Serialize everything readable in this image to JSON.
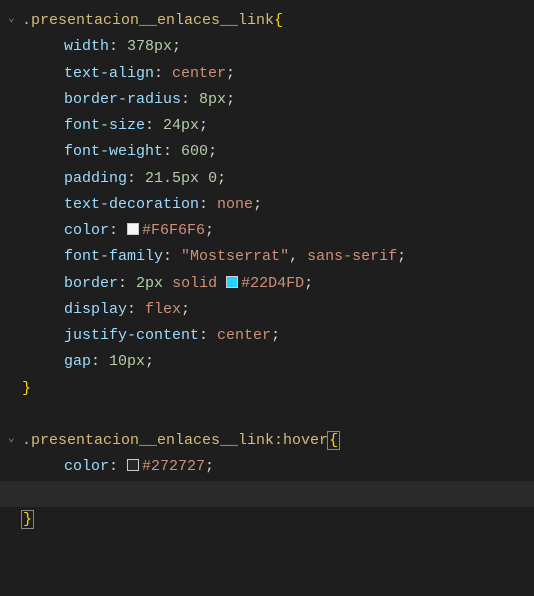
{
  "rules": [
    {
      "selector": ".presentacion__enlaces__link",
      "open_brace": "{",
      "close_brace": "}",
      "declarations": [
        {
          "prop": "width",
          "num": "378px",
          "tail": ";"
        },
        {
          "prop": "text-align",
          "val": "center",
          "tail": ";"
        },
        {
          "prop": "border-radius",
          "num": "8px",
          "tail": ";"
        },
        {
          "prop": "font-size",
          "num": "24px",
          "tail": ";"
        },
        {
          "prop": "font-weight",
          "num": "600",
          "tail": ";"
        },
        {
          "prop": "padding",
          "num": "21.5px",
          "num2": "0",
          "tail": ";"
        },
        {
          "prop": "text-decoration",
          "val": "none",
          "tail": ";"
        },
        {
          "prop": "color",
          "swatch": "#F6F6F6",
          "hex": "#F6F6F6",
          "tail": ";"
        },
        {
          "prop": "font-family",
          "str": "\"Mostserrat\"",
          "comma": ",",
          "val2": "sans-serif",
          "tail": ";"
        },
        {
          "prop": "border",
          "num": "2px",
          "kw": "solid",
          "swatch": "#22D4FD",
          "hex": "#22D4FD",
          "tail": ";"
        },
        {
          "prop": "display",
          "val": "flex",
          "tail": ";"
        },
        {
          "prop": "justify-content",
          "val": "center",
          "tail": ";"
        },
        {
          "prop": "gap",
          "num": "10px",
          "tail": ";"
        }
      ]
    },
    {
      "selector": ".presentacion__enlaces__link:hover",
      "open_brace": "{",
      "close_brace": "}",
      "declarations": [
        {
          "prop": "color",
          "swatch": "#272727",
          "hex": "#272727",
          "tail": ";"
        }
      ]
    }
  ],
  "glyphs": {
    "chevron_down": "⌄"
  }
}
